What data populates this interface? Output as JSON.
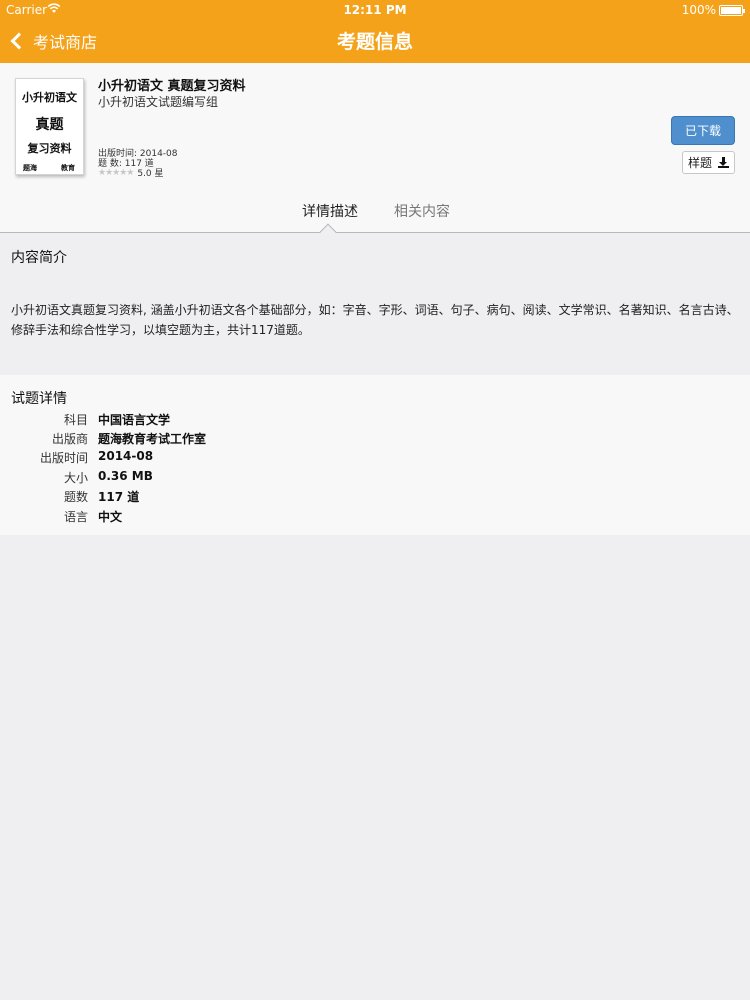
{
  "status_bar": {
    "carrier": "Carrier",
    "time": "12:11 PM",
    "battery": "100%",
    "battery_level": 1.0
  },
  "nav": {
    "back_label": "考试商店",
    "title": "考题信息"
  },
  "book": {
    "cover": {
      "line1": "小升初语文",
      "line2": "真题",
      "line3": "复习资料",
      "footer_left": "题海",
      "footer_right": "教育"
    },
    "title": "小升初语文 真题复习资料",
    "author": "小升初语文试题编写组",
    "publish_date": "出版时间: 2014-08",
    "question_count": "题      数: 117 道",
    "stars": "★★★★★",
    "rating": "5.0 星",
    "rating_value": 5.0
  },
  "actions": {
    "downloaded_label": "已下载",
    "sample_label": "样题",
    "sample_icon": "download-icon"
  },
  "tabs": [
    {
      "label": "详情描述",
      "active": true
    },
    {
      "label": "相关内容",
      "active": false
    }
  ],
  "intro": {
    "title": "内容简介",
    "text": "小升初语文真题复习资料, 涵盖小升初语文各个基础部分，如：字音、字形、词语、句子、病句、阅读、文学常识、名著知识、名言古诗、修辞手法和综合性学习，以填空题为主，共计117道题。"
  },
  "details": {
    "title": "试题详情",
    "rows": [
      {
        "label": "科目",
        "value": "中国语言文学"
      },
      {
        "label": "出版商",
        "value": "题海教育考试工作室"
      },
      {
        "label": "出版时间",
        "value": "2014-08"
      },
      {
        "label": "大小",
        "value": "0.36 MB"
      },
      {
        "label": "题数",
        "value": "117 道"
      },
      {
        "label": "语言",
        "value": "中文"
      }
    ]
  },
  "colors": {
    "nav_bar": "#f5a21b",
    "downloaded_button": "#4f8fce",
    "background": "#efeef0"
  }
}
